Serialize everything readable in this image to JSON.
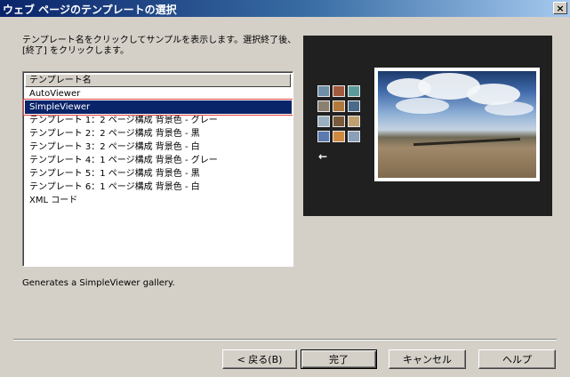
{
  "window": {
    "title": "ウェブ ページのテンプレートの選択",
    "close_label": "×"
  },
  "instruction": "テンプレート名をクリックしてサンプルを表示します。選択終了後、[終了] をクリックします。",
  "template_list": {
    "header": "テンプレート名",
    "items": [
      "AutoViewer",
      "SimpleViewer",
      "テンプレート 1：2 ページ構成 背景色 - グレー",
      "テンプレート 2：2 ページ構成 背景色 - 黒",
      "テンプレート 3：2 ページ構成 背景色 - 白",
      "テンプレート 4：1 ページ構成 背景色 - グレー",
      "テンプレート 5：1 ページ構成 背景色 - 黒",
      "テンプレート 6：1 ページ構成 背景色 - 白",
      "XML コード"
    ],
    "selected": "SimpleViewer"
  },
  "preview": {
    "arrow": "←",
    "thumb_colors": [
      "#6f8fa8",
      "#a05a3c",
      "#5a9a9a",
      "#8a8070",
      "#b07a3a",
      "#4a6a8a",
      "#9ab0c0",
      "#7a5a3a",
      "#c0a070",
      "#5a7ab0",
      "#d08a40",
      "#8aa0b8"
    ]
  },
  "description": "Generates a SimpleViewer gallery.",
  "buttons": {
    "back": "< 戻る(B)",
    "finish": "完了",
    "cancel": "キャンセル",
    "help": "ヘルプ"
  }
}
